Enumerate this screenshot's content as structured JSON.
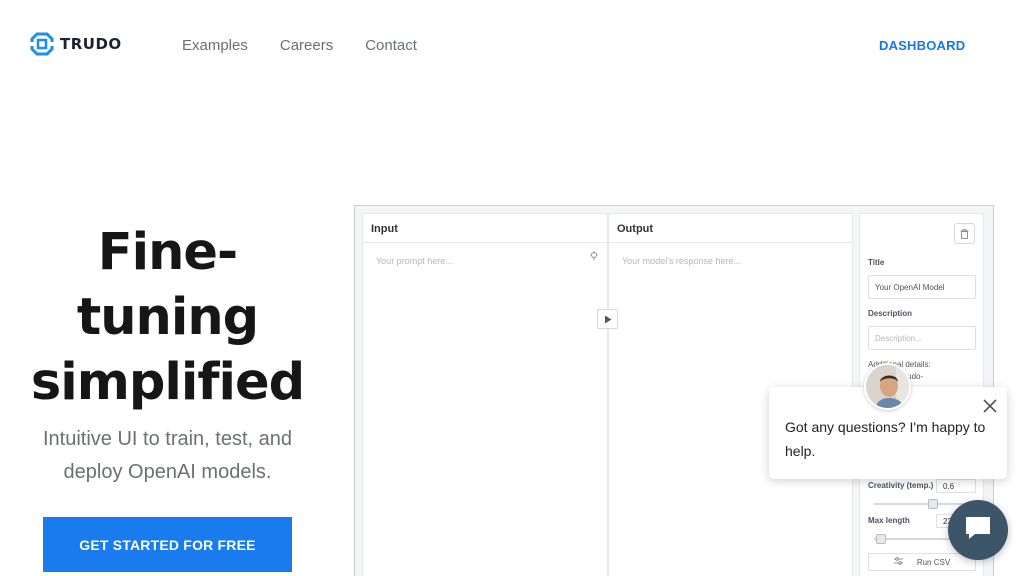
{
  "nav": {
    "logo_text": "TRUDO",
    "links": [
      "Examples",
      "Careers",
      "Contact"
    ],
    "dashboard": "DASHBOARD"
  },
  "hero": {
    "title_lines": [
      "Fine-",
      "tuning",
      "simplified"
    ],
    "subtitle_lines": [
      "Intuitive UI to train, test, and",
      "deploy OpenAI models."
    ],
    "cta": "GET STARTED FOR FREE"
  },
  "mockup": {
    "input_header": "Input",
    "input_placeholder": "Your prompt here...",
    "output_header": "Output",
    "output_placeholder": "Your model's response here...",
    "side": {
      "title_label": "Title",
      "title_value": "Your OpenAI Model",
      "description_label": "Description",
      "description_placeholder": "Description...",
      "details_line1": "Additional details:",
      "details_line2": "davinci:ft-trudo-",
      "creativity_label": "Creativity (temp.)",
      "creativity_value": "0.6",
      "max_length_label": "Max length",
      "max_length_value": "23",
      "run_csv": "Run CSV"
    }
  },
  "controls": {
    "creativity_fraction": 0.6,
    "max_length_fraction": 0.02
  },
  "chat": {
    "message": "Got any questions? I'm happy to help."
  },
  "colors": {
    "accent": "#1a7bef",
    "dashboard_link": "#1877e6",
    "launcher": "#3c5568",
    "logo": "#1b8ff0"
  },
  "icons": [
    "logo-icon",
    "lightbulb-icon",
    "play-icon",
    "trash-icon",
    "csv-icon",
    "close-icon",
    "chat-icon"
  ]
}
